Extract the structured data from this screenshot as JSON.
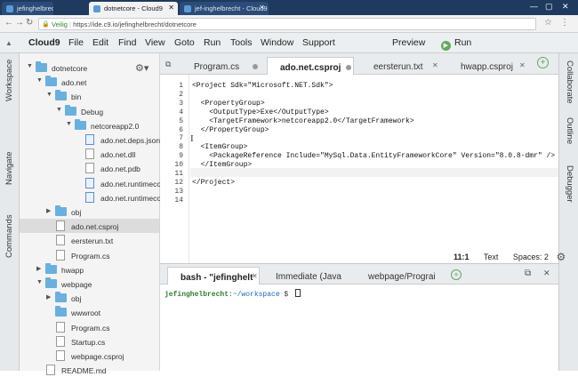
{
  "browser": {
    "tabs": [
      {
        "title": "jefinghelbrecht"
      },
      {
        "title": "dotnetcore - Cloud9"
      },
      {
        "title": "jef-inghelbrecht - Cloud9"
      }
    ],
    "url_secure_label": "Veilig",
    "url": "https://ide.c9.io/jefinghelbrecht/dotnetcore"
  },
  "menu": {
    "logo": "Cloud9",
    "items": [
      "File",
      "Edit",
      "Find",
      "View",
      "Goto",
      "Run",
      "Tools",
      "Window",
      "Support"
    ],
    "preview": "Preview",
    "run": "Run"
  },
  "sidebar_left": [
    "Workspace",
    "Navigate",
    "Commands"
  ],
  "sidebar_right": [
    "Collaborate",
    "Outline",
    "Debugger"
  ],
  "tree": [
    {
      "label": "dotnetcore",
      "type": "folder",
      "depth": 0,
      "open": true
    },
    {
      "label": "ado.net",
      "type": "folder",
      "depth": 1,
      "open": true
    },
    {
      "label": "bin",
      "type": "folder",
      "depth": 2,
      "open": true
    },
    {
      "label": "Debug",
      "type": "folder",
      "depth": 3,
      "open": true
    },
    {
      "label": "netcoreapp2.0",
      "type": "folder",
      "depth": 4,
      "open": true
    },
    {
      "label": "ado.net.deps.json",
      "type": "dll",
      "depth": 5
    },
    {
      "label": "ado.net.dll",
      "type": "file",
      "depth": 5
    },
    {
      "label": "ado.net.pdb",
      "type": "file",
      "depth": 5
    },
    {
      "label": "ado.net.runtimeco",
      "type": "dll",
      "depth": 5
    },
    {
      "label": "ado.net.runtimeco",
      "type": "dll",
      "depth": 5
    },
    {
      "label": "obj",
      "type": "folder",
      "depth": 2,
      "open": false
    },
    {
      "label": "ado.net.csproj",
      "type": "file",
      "depth": 2,
      "selected": true
    },
    {
      "label": "eersterun.txt",
      "type": "file",
      "depth": 2
    },
    {
      "label": "Program.cs",
      "type": "file",
      "depth": 2
    },
    {
      "label": "hwapp",
      "type": "folder",
      "depth": 1,
      "open": false
    },
    {
      "label": "webpage",
      "type": "folder",
      "depth": 1,
      "open": true
    },
    {
      "label": "obj",
      "type": "folder",
      "depth": 2,
      "open": false
    },
    {
      "label": "wwwroot",
      "type": "folder",
      "depth": 2,
      "open": null
    },
    {
      "label": "Program.cs",
      "type": "file",
      "depth": 2
    },
    {
      "label": "Startup.cs",
      "type": "file",
      "depth": 2
    },
    {
      "label": "webpage.csproj",
      "type": "file",
      "depth": 2
    },
    {
      "label": "README.md",
      "type": "file",
      "depth": 1
    }
  ],
  "editor": {
    "tabs": [
      {
        "label": "Program.cs",
        "state": "dot"
      },
      {
        "label": "ado.net.csproj",
        "state": "dot",
        "active": true
      },
      {
        "label": "eersterun.txt",
        "state": "close"
      },
      {
        "label": "hwapp.csproj",
        "state": "close"
      }
    ],
    "lines": [
      "<Project Sdk=\"Microsoft.NET.Sdk\">",
      "",
      "  <PropertyGroup>",
      "    <OutputType>Exe</OutputType>",
      "    <TargetFramework>netcoreapp2.0</TargetFramework>",
      "  </PropertyGroup>",
      "",
      "  <ItemGroup>",
      "    <PackageReference Include=\"MySql.Data.EntityFrameworkCore\" Version=\"8.0.8-dmr\" />",
      "  </ItemGroup>",
      "",
      "</Project>",
      "",
      ""
    ],
    "line_numbers": [
      "1",
      "2",
      "3",
      "4",
      "5",
      "6",
      "7",
      "8",
      "9",
      "10",
      "11",
      "12",
      "13",
      "14"
    ],
    "status_position": "11:1",
    "status_mode": "Text",
    "status_spaces": "Spaces: 2"
  },
  "terminal": {
    "tabs": [
      {
        "label": "bash - \"jefinghelt",
        "active": true
      },
      {
        "label": "Immediate (Java"
      },
      {
        "label": "webpage/Prograi"
      }
    ],
    "prompt_user": "jefinghelbrecht",
    "prompt_path": ":~/workspace",
    "prompt_symbol": " $ "
  }
}
